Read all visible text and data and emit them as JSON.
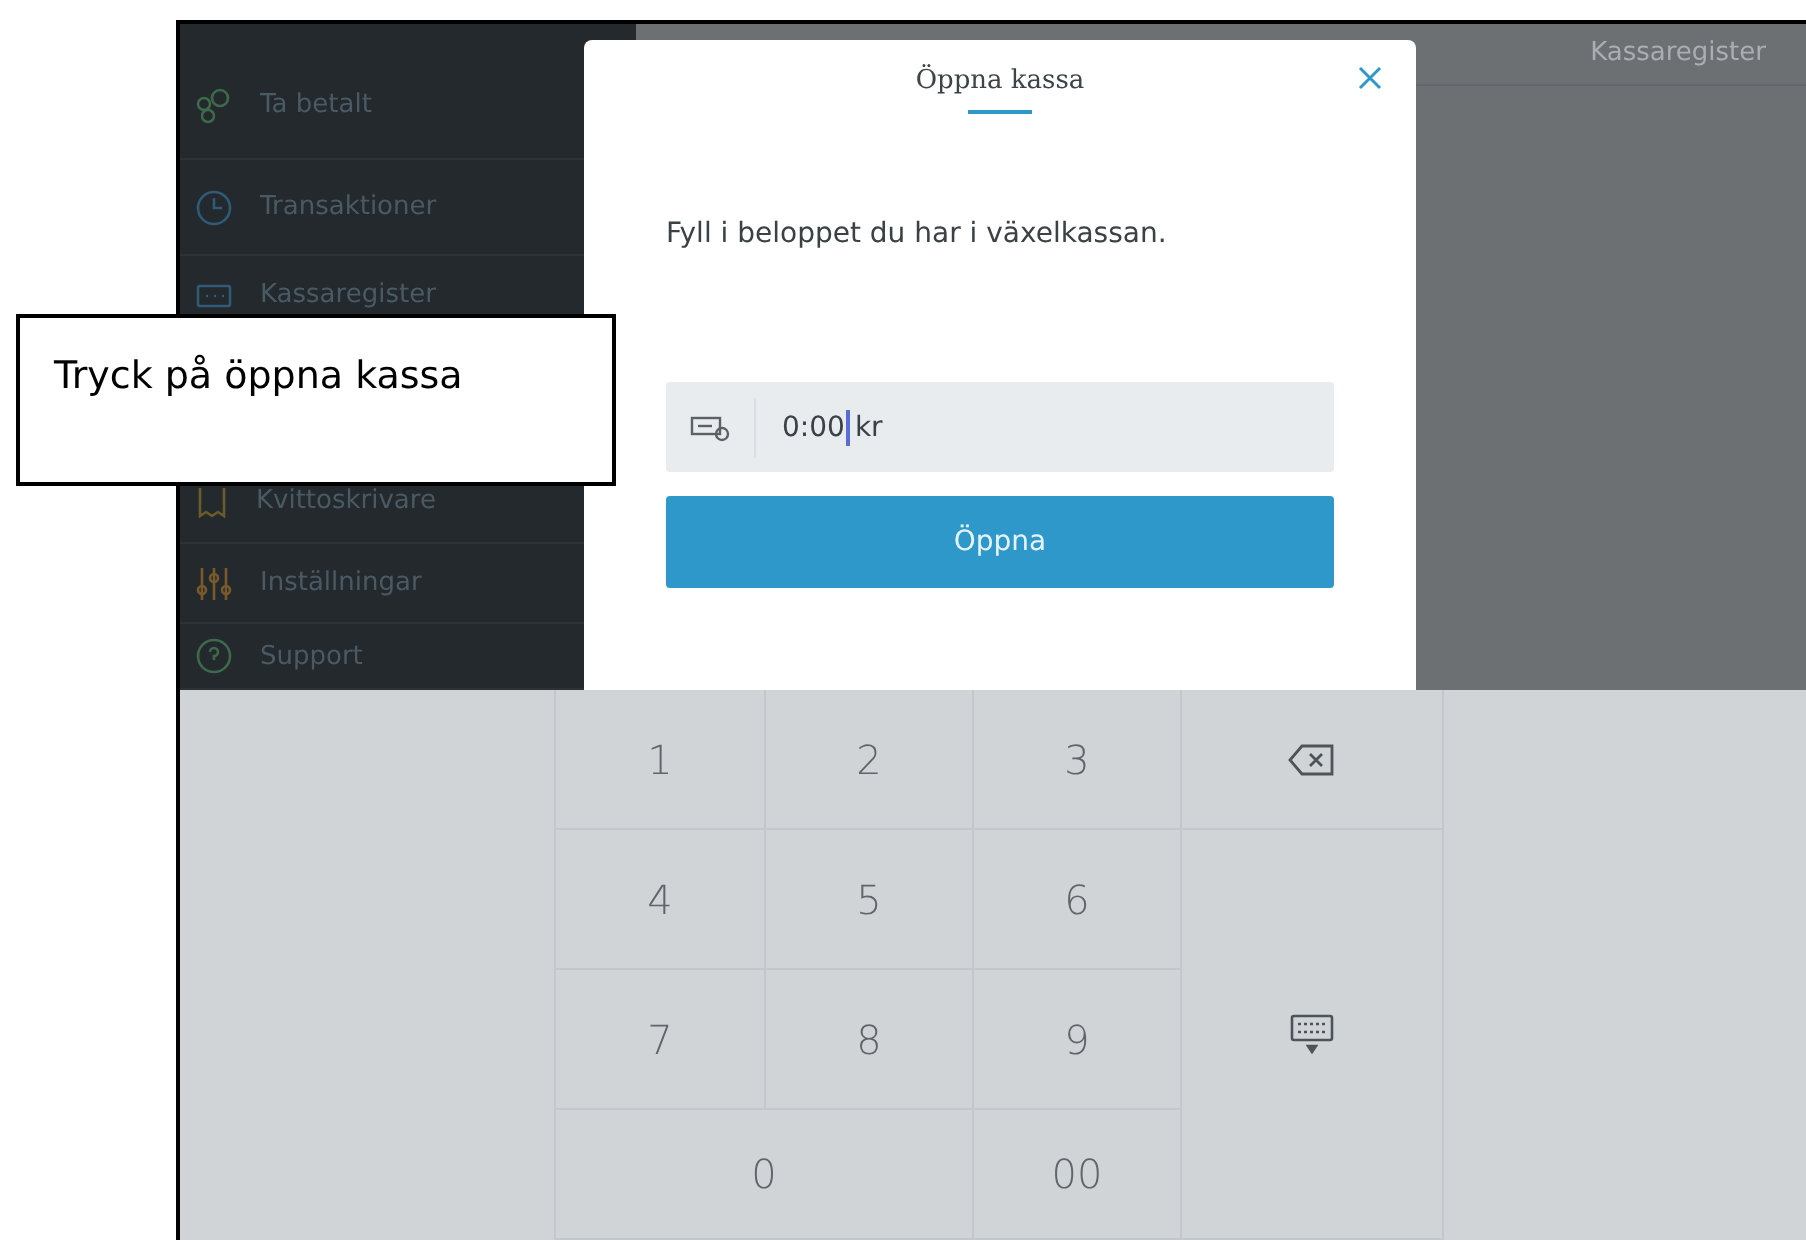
{
  "callout": {
    "text": "Tryck på öppna kassa"
  },
  "sidebar": {
    "items": [
      {
        "label": "Ta betalt"
      },
      {
        "label": "Transaktioner"
      },
      {
        "label": "Kassaregister"
      },
      {
        "label": "Kvittoskrivare"
      },
      {
        "label": "Inställningar"
      },
      {
        "label": "Support"
      }
    ]
  },
  "main": {
    "title": "Kassaregister"
  },
  "dialog": {
    "title": "Öppna kassa",
    "message": "Fyll i beloppet du har i växelkassan.",
    "amount": {
      "value": "0:00",
      "suffix": "kr"
    },
    "button": "Öppna"
  },
  "keypad": {
    "keys": [
      {
        "kind": "digit",
        "label": "1"
      },
      {
        "kind": "digit",
        "label": "2"
      },
      {
        "kind": "digit",
        "label": "3"
      },
      {
        "kind": "backspace"
      },
      {
        "kind": "digit",
        "label": "4"
      },
      {
        "kind": "digit",
        "label": "5"
      },
      {
        "kind": "digit",
        "label": "6"
      },
      {
        "kind": "hide_keyboard"
      },
      {
        "kind": "digit",
        "label": "7"
      },
      {
        "kind": "digit",
        "label": "8"
      },
      {
        "kind": "digit",
        "label": "9"
      },
      {
        "kind": "digit",
        "label": "0"
      },
      {
        "kind": "digit",
        "label": "00"
      }
    ]
  }
}
